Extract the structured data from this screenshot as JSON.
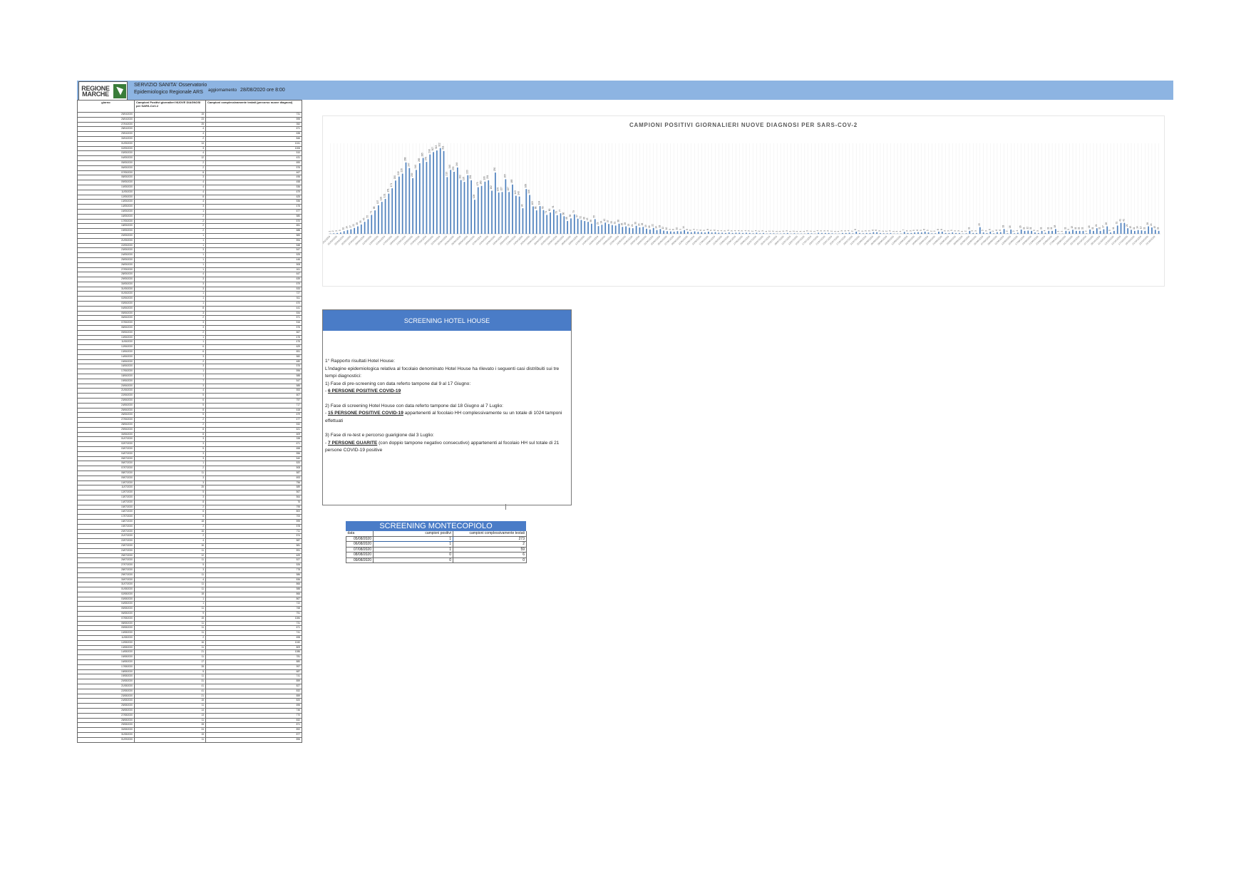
{
  "header": {
    "logo_line1": "REGIONE",
    "logo_line2": "MARCHE",
    "org_line1": "SERVIZIO SANITA' Osservatorio",
    "org_line2": "Epidemiologico Regionale ARS",
    "update_label": "aggiornamento",
    "update_value": "28/08/2020 ore 8:00"
  },
  "left_table": {
    "col_headers": [
      "giorno",
      "Campioni Positivi giornalieri NUOVE DIAGNOSI per SARS-CoV-2",
      "Campioni complessivamente testati (percorso nuove diagnosi)"
    ],
    "rows": [
      [
        "25/04/2020",
        "15",
        "731"
      ],
      [
        "26/04/2020",
        "23",
        "595"
      ],
      [
        "27/04/2020",
        "25",
        "352"
      ],
      [
        "28/04/2020",
        "4",
        "671"
      ],
      [
        "29/04/2020",
        "4",
        "638"
      ],
      [
        "30/04/2020",
        "2",
        "846"
      ],
      [
        "01/05/2020",
        "14",
        "1041"
      ],
      [
        "02/05/2020",
        "3",
        "1006"
      ],
      [
        "03/05/2020",
        "4",
        "510"
      ],
      [
        "04/05/2020",
        "12",
        "431"
      ],
      [
        "05/05/2020",
        "2",
        "690"
      ],
      [
        "06/05/2020",
        "2",
        "576"
      ],
      [
        "07/05/2020",
        "8",
        "467"
      ],
      [
        "08/05/2020",
        "3",
        "496"
      ],
      [
        "09/05/2020",
        "4",
        "458"
      ],
      [
        "10/05/2020",
        "4",
        "536"
      ],
      [
        "11/05/2020",
        "4",
        "679"
      ],
      [
        "12/05/2020",
        "8",
        "625"
      ],
      [
        "13/05/2020",
        "4",
        "536"
      ],
      [
        "14/05/2020",
        "3",
        "476"
      ],
      [
        "15/05/2020",
        "1",
        "677"
      ],
      [
        "16/05/2020",
        "2",
        "580"
      ],
      [
        "17/05/2020",
        "2",
        "570"
      ],
      [
        "18/05/2020",
        "2",
        "651"
      ],
      [
        "19/05/2020",
        "2",
        "688"
      ],
      [
        "20/05/2020",
        "1",
        "583"
      ],
      [
        "21/05/2020",
        "1",
        "594"
      ],
      [
        "22/05/2020",
        "1",
        "548"
      ],
      [
        "23/05/2020",
        "3",
        "547"
      ],
      [
        "24/05/2020",
        "1",
        "525"
      ],
      [
        "25/05/2020",
        "1",
        "446"
      ],
      [
        "26/05/2020",
        "1",
        "508"
      ],
      [
        "27/05/2020",
        "1",
        "611"
      ],
      [
        "28/05/2020",
        "4",
        "647"
      ],
      [
        "29/05/2020",
        "3",
        "639"
      ],
      [
        "30/05/2020",
        "3",
        "579"
      ],
      [
        "31/05/2020",
        "3",
        "533"
      ],
      [
        "01/06/2020",
        "1",
        "727"
      ],
      [
        "02/06/2020",
        "1",
        "511"
      ],
      [
        "03/06/2020",
        "1",
        "670"
      ],
      [
        "04/06/2020",
        "8",
        "441"
      ],
      [
        "05/06/2020",
        "3",
        "534"
      ],
      [
        "06/06/2020",
        "2",
        "571"
      ],
      [
        "07/06/2020",
        "3",
        "516"
      ],
      [
        "08/06/2020",
        "3",
        "576"
      ],
      [
        "09/06/2020",
        "2",
        "667"
      ],
      [
        "10/06/2020",
        "1",
        "476"
      ],
      [
        "11/06/2020",
        "1",
        "476"
      ],
      [
        "12/06/2020",
        "6",
        "629"
      ],
      [
        "13/06/2020",
        "6",
        "651"
      ],
      [
        "14/06/2020",
        "3",
        "582"
      ],
      [
        "15/06/2020",
        "2",
        "480"
      ],
      [
        "16/06/2020",
        "3",
        "576"
      ],
      [
        "17/06/2020",
        "1",
        "596"
      ],
      [
        "18/06/2020",
        "1",
        "588"
      ],
      [
        "19/06/2020",
        "7",
        "547"
      ],
      [
        "20/06/2020",
        "3",
        "585"
      ],
      [
        "21/06/2020",
        "4",
        "553"
      ],
      [
        "22/06/2020",
        "5",
        "607"
      ],
      [
        "23/06/2020",
        "6",
        "757"
      ],
      [
        "24/06/2020",
        "5",
        "717"
      ],
      [
        "25/06/2020",
        "8",
        "618"
      ],
      [
        "26/06/2020",
        "5",
        "679"
      ],
      [
        "27/06/2020",
        "2",
        "477"
      ],
      [
        "28/06/2020",
        "2",
        "532"
      ],
      [
        "29/06/2020",
        "8",
        "621"
      ],
      [
        "30/06/2020",
        "8",
        "609"
      ],
      [
        "01/07/2020",
        "3",
        "338"
      ],
      [
        "02/07/2020",
        "3",
        "671"
      ],
      [
        "03/07/2020",
        "5",
        "658"
      ],
      [
        "04/07/2020",
        "3",
        "556"
      ],
      [
        "05/07/2020",
        "3",
        "540"
      ],
      [
        "06/07/2020",
        "1",
        "520"
      ],
      [
        "07/07/2020",
        "2",
        "508"
      ],
      [
        "08/07/2020",
        "11",
        "587"
      ],
      [
        "09/07/2020",
        "3",
        "693"
      ],
      [
        "10/07/2020",
        "3",
        "756"
      ],
      [
        "11/07/2020",
        "25",
        "589"
      ],
      [
        "12/07/2020",
        "5",
        "567"
      ],
      [
        "13/07/2020",
        "3",
        "564"
      ],
      [
        "14/07/2020",
        "8",
        "76"
      ],
      [
        "15/07/2020",
        "2",
        "795"
      ],
      [
        "16/07/2020",
        "6",
        "800"
      ],
      [
        "17/07/2020",
        "6",
        "700"
      ],
      [
        "18/07/2020",
        "18",
        "595"
      ],
      [
        "19/07/2020",
        "2",
        "578"
      ],
      [
        "20/07/2020",
        "16",
        "711"
      ],
      [
        "21/07/2020",
        "2",
        "574"
      ],
      [
        "22/07/2020",
        "4",
        "587"
      ],
      [
        "23/07/2020",
        "16",
        "581"
      ],
      [
        "24/07/2020",
        "11",
        "591"
      ],
      [
        "25/07/2020",
        "12",
        "629"
      ],
      [
        "26/07/2020",
        "11",
        "527"
      ],
      [
        "27/07/2020",
        "5",
        "526"
      ],
      [
        "28/07/2020",
        "3",
        "778"
      ],
      [
        "29/07/2020",
        "11",
        "586"
      ],
      [
        "30/07/2020",
        "4",
        "836"
      ],
      [
        "31/07/2020",
        "11",
        "866"
      ],
      [
        "01/08/2020",
        "11",
        "588"
      ],
      [
        "02/08/2020",
        "18",
        "866"
      ],
      [
        "03/08/2020",
        "1",
        "867"
      ],
      [
        "04/08/2020",
        "1",
        "722"
      ],
      [
        "05/08/2020",
        "11",
        "768"
      ],
      [
        "06/08/2020",
        "9",
        "751"
      ],
      [
        "07/08/2020",
        "15",
        "1084"
      ],
      [
        "08/08/2020",
        "11",
        "731"
      ],
      [
        "09/08/2020",
        "11",
        "671"
      ],
      [
        "10/08/2020",
        "11",
        "741"
      ],
      [
        "11/08/2020",
        "2",
        "698"
      ],
      [
        "12/08/2020",
        "16",
        "1040"
      ],
      [
        "13/08/2020",
        "11",
        "809"
      ],
      [
        "14/08/2020",
        "21",
        "1086"
      ],
      [
        "15/08/2020",
        "11",
        "781"
      ],
      [
        "16/08/2020",
        "17",
        "880"
      ],
      [
        "17/08/2020",
        "28",
        "997"
      ],
      [
        "18/08/2020",
        "5",
        "687"
      ],
      [
        "19/08/2020",
        "11",
        "741"
      ],
      [
        "20/08/2020",
        "31",
        "859"
      ],
      [
        "21/08/2020",
        "41",
        "827"
      ],
      [
        "22/08/2020",
        "41",
        "832"
      ],
      [
        "23/08/2020",
        "21",
        "859"
      ],
      [
        "24/08/2020",
        "15",
        "820"
      ],
      [
        "25/08/2020",
        "11",
        "696"
      ],
      [
        "26/08/2020",
        "14",
        "746"
      ],
      [
        "27/08/2020",
        "13",
        "770"
      ],
      [
        "28/08/2020",
        "11",
        "832"
      ],
      [
        "29/08/2020",
        "28",
        "871"
      ],
      [
        "30/08/2020",
        "24",
        "892"
      ],
      [
        "31/08/2020",
        "15",
        "877"
      ],
      [
        "01/09/2020",
        "11",
        "896"
      ]
    ]
  },
  "chart_data": {
    "type": "bar",
    "title": "CAMPIONI POSITIVI GIORNALIERI NUOVE DIAGNOSI PER SARS-COV-2",
    "start_date": "28/02/2020",
    "categories_step_label": 2,
    "values": [
      1,
      2,
      3,
      5,
      10,
      14,
      17,
      22,
      28,
      35,
      45,
      55,
      71,
      88,
      107,
      120,
      131,
      151,
      171,
      200,
      215,
      226,
      268,
      247,
      209,
      240,
      265,
      285,
      270,
      298,
      307,
      313,
      322,
      311,
      213,
      240,
      233,
      249,
      202,
      195,
      220,
      201,
      128,
      175,
      180,
      196,
      201,
      162,
      230,
      155,
      157,
      205,
      157,
      185,
      143,
      140,
      96,
      168,
      146,
      103,
      88,
      104,
      89,
      71,
      80,
      91,
      70,
      77,
      66,
      48,
      58,
      73,
      57,
      52,
      48,
      45,
      38,
      55,
      29,
      34,
      42,
      37,
      33,
      31,
      38,
      26,
      28,
      23,
      21,
      30,
      24,
      26,
      19,
      16,
      22,
      14,
      18,
      12,
      10,
      9,
      8,
      10,
      9,
      14,
      8,
      6,
      9,
      7,
      6,
      5,
      8,
      5,
      6,
      4,
      4,
      3,
      5,
      3,
      4,
      4,
      3,
      4,
      3,
      2,
      4,
      2,
      3,
      1,
      2,
      2,
      1,
      1,
      2,
      3,
      1,
      2,
      1,
      1,
      1,
      3,
      2,
      1,
      4,
      3,
      3,
      3,
      2,
      1,
      1,
      3,
      3,
      4,
      2,
      8,
      3,
      2,
      3,
      3,
      6,
      6,
      3,
      2,
      2,
      3,
      1,
      1,
      1,
      7,
      3,
      3,
      5,
      6,
      5,
      8,
      5,
      2,
      2,
      8,
      8,
      3,
      3,
      5,
      3,
      3,
      1,
      2,
      11,
      3,
      3,
      25,
      5,
      3,
      8,
      2,
      6,
      6,
      18,
      2,
      16,
      2,
      4,
      16,
      11,
      12,
      11,
      5,
      3,
      11,
      4,
      11,
      11,
      18,
      1,
      1,
      11,
      9,
      15,
      11,
      11,
      11,
      2,
      16,
      11,
      21,
      11,
      17,
      28,
      5,
      11,
      31,
      41,
      41,
      21,
      15,
      11,
      14,
      13,
      11,
      28,
      24,
      15,
      11
    ],
    "ylim": [
      0,
      340
    ],
    "label_every": 1
  },
  "hotel_house": {
    "title": "SCREENING HOTEL HOUSE",
    "lines": [
      "1° Rapporto risultati Hotel House:",
      "L'indagine epidemiologica relativa al focolaio denominato Hotel House ha rilevato i seguenti casi distribuiti sui tre tempi diagnostici:",
      "1) Fase di pre-screening con data referto tampone dal 9 al 17 Giugno:"
    ],
    "l1_bold": "6 PERSONE POSITIVE COVID-19",
    "p2_head": "2) Fase di screening Hotel House con data referto tampone dal 18 Giugno al 7 Luglio:",
    "p2_bold": "15 PERSONE POSITIVE COVID-19",
    "p2_rest": " appartenenti al focolaio HH complessivamente su un totale di 1024 tamponi effettuati",
    "p3_head": "3) Fase di re-test e percorso guarigione dal 3 Luglio:",
    "p3_bold": "7 PERSONE GUARITE",
    "p3_rest": " (con doppio tampone negativo consecutivo) appartenenti al focolaio HH sul totale di 21 persone COVID-19 positive"
  },
  "montecopiolo": {
    "title": "SCREENING MONTECOPIOLO",
    "headers": [
      "data",
      "campioni positivi",
      "campioni complessivamente testati"
    ],
    "rows": [
      [
        "05/08/2020",
        "1",
        "273"
      ],
      [
        "06/08/2020",
        "1",
        "2"
      ],
      [
        "07/08/2020",
        "1",
        "59"
      ],
      [
        "08/08/2020",
        "0",
        "6"
      ],
      [
        "09/08/2020",
        "0",
        "0"
      ]
    ]
  },
  "colors": {
    "banner": "#8db4e2",
    "accent": "#4a7cc7",
    "bar": "#4f81bd"
  }
}
